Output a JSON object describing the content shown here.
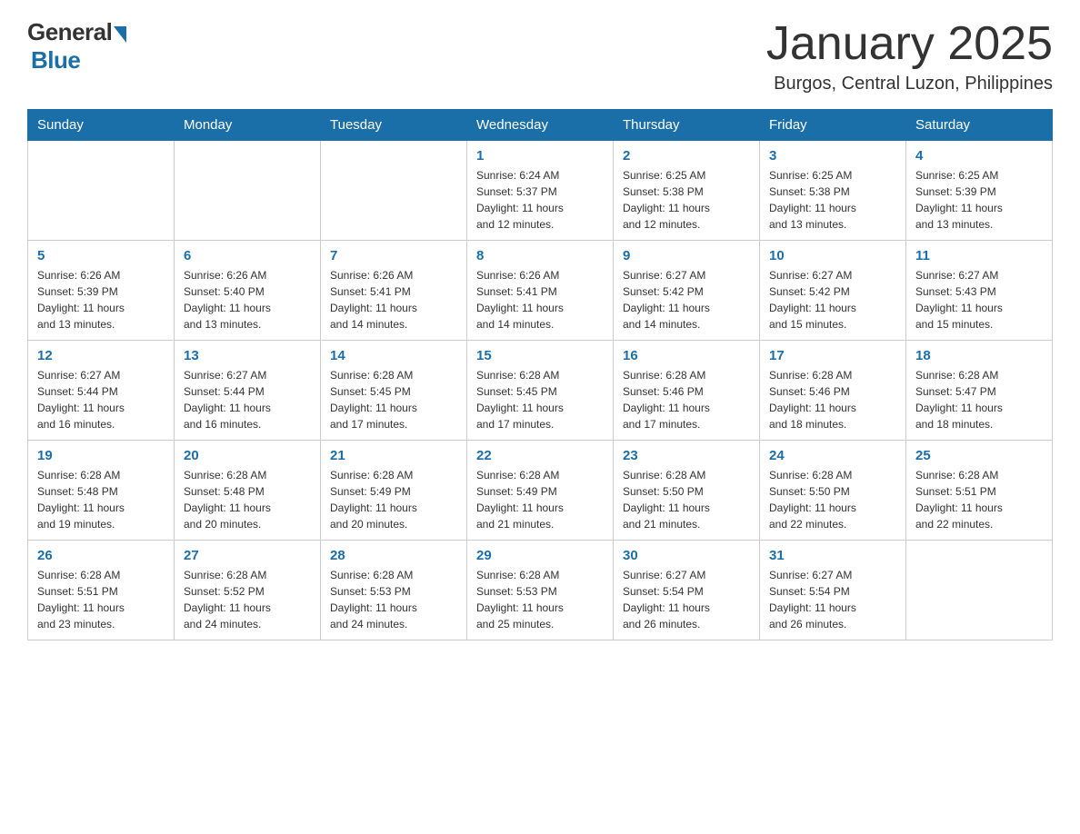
{
  "header": {
    "logo": {
      "general": "General",
      "blue": "Blue"
    },
    "title": "January 2025",
    "location": "Burgos, Central Luzon, Philippines"
  },
  "days_of_week": [
    "Sunday",
    "Monday",
    "Tuesday",
    "Wednesday",
    "Thursday",
    "Friday",
    "Saturday"
  ],
  "weeks": [
    [
      {
        "day": "",
        "info": ""
      },
      {
        "day": "",
        "info": ""
      },
      {
        "day": "",
        "info": ""
      },
      {
        "day": "1",
        "info": "Sunrise: 6:24 AM\nSunset: 5:37 PM\nDaylight: 11 hours\nand 12 minutes."
      },
      {
        "day": "2",
        "info": "Sunrise: 6:25 AM\nSunset: 5:38 PM\nDaylight: 11 hours\nand 12 minutes."
      },
      {
        "day": "3",
        "info": "Sunrise: 6:25 AM\nSunset: 5:38 PM\nDaylight: 11 hours\nand 13 minutes."
      },
      {
        "day": "4",
        "info": "Sunrise: 6:25 AM\nSunset: 5:39 PM\nDaylight: 11 hours\nand 13 minutes."
      }
    ],
    [
      {
        "day": "5",
        "info": "Sunrise: 6:26 AM\nSunset: 5:39 PM\nDaylight: 11 hours\nand 13 minutes."
      },
      {
        "day": "6",
        "info": "Sunrise: 6:26 AM\nSunset: 5:40 PM\nDaylight: 11 hours\nand 13 minutes."
      },
      {
        "day": "7",
        "info": "Sunrise: 6:26 AM\nSunset: 5:41 PM\nDaylight: 11 hours\nand 14 minutes."
      },
      {
        "day": "8",
        "info": "Sunrise: 6:26 AM\nSunset: 5:41 PM\nDaylight: 11 hours\nand 14 minutes."
      },
      {
        "day": "9",
        "info": "Sunrise: 6:27 AM\nSunset: 5:42 PM\nDaylight: 11 hours\nand 14 minutes."
      },
      {
        "day": "10",
        "info": "Sunrise: 6:27 AM\nSunset: 5:42 PM\nDaylight: 11 hours\nand 15 minutes."
      },
      {
        "day": "11",
        "info": "Sunrise: 6:27 AM\nSunset: 5:43 PM\nDaylight: 11 hours\nand 15 minutes."
      }
    ],
    [
      {
        "day": "12",
        "info": "Sunrise: 6:27 AM\nSunset: 5:44 PM\nDaylight: 11 hours\nand 16 minutes."
      },
      {
        "day": "13",
        "info": "Sunrise: 6:27 AM\nSunset: 5:44 PM\nDaylight: 11 hours\nand 16 minutes."
      },
      {
        "day": "14",
        "info": "Sunrise: 6:28 AM\nSunset: 5:45 PM\nDaylight: 11 hours\nand 17 minutes."
      },
      {
        "day": "15",
        "info": "Sunrise: 6:28 AM\nSunset: 5:45 PM\nDaylight: 11 hours\nand 17 minutes."
      },
      {
        "day": "16",
        "info": "Sunrise: 6:28 AM\nSunset: 5:46 PM\nDaylight: 11 hours\nand 17 minutes."
      },
      {
        "day": "17",
        "info": "Sunrise: 6:28 AM\nSunset: 5:46 PM\nDaylight: 11 hours\nand 18 minutes."
      },
      {
        "day": "18",
        "info": "Sunrise: 6:28 AM\nSunset: 5:47 PM\nDaylight: 11 hours\nand 18 minutes."
      }
    ],
    [
      {
        "day": "19",
        "info": "Sunrise: 6:28 AM\nSunset: 5:48 PM\nDaylight: 11 hours\nand 19 minutes."
      },
      {
        "day": "20",
        "info": "Sunrise: 6:28 AM\nSunset: 5:48 PM\nDaylight: 11 hours\nand 20 minutes."
      },
      {
        "day": "21",
        "info": "Sunrise: 6:28 AM\nSunset: 5:49 PM\nDaylight: 11 hours\nand 20 minutes."
      },
      {
        "day": "22",
        "info": "Sunrise: 6:28 AM\nSunset: 5:49 PM\nDaylight: 11 hours\nand 21 minutes."
      },
      {
        "day": "23",
        "info": "Sunrise: 6:28 AM\nSunset: 5:50 PM\nDaylight: 11 hours\nand 21 minutes."
      },
      {
        "day": "24",
        "info": "Sunrise: 6:28 AM\nSunset: 5:50 PM\nDaylight: 11 hours\nand 22 minutes."
      },
      {
        "day": "25",
        "info": "Sunrise: 6:28 AM\nSunset: 5:51 PM\nDaylight: 11 hours\nand 22 minutes."
      }
    ],
    [
      {
        "day": "26",
        "info": "Sunrise: 6:28 AM\nSunset: 5:51 PM\nDaylight: 11 hours\nand 23 minutes."
      },
      {
        "day": "27",
        "info": "Sunrise: 6:28 AM\nSunset: 5:52 PM\nDaylight: 11 hours\nand 24 minutes."
      },
      {
        "day": "28",
        "info": "Sunrise: 6:28 AM\nSunset: 5:53 PM\nDaylight: 11 hours\nand 24 minutes."
      },
      {
        "day": "29",
        "info": "Sunrise: 6:28 AM\nSunset: 5:53 PM\nDaylight: 11 hours\nand 25 minutes."
      },
      {
        "day": "30",
        "info": "Sunrise: 6:27 AM\nSunset: 5:54 PM\nDaylight: 11 hours\nand 26 minutes."
      },
      {
        "day": "31",
        "info": "Sunrise: 6:27 AM\nSunset: 5:54 PM\nDaylight: 11 hours\nand 26 minutes."
      },
      {
        "day": "",
        "info": ""
      }
    ]
  ]
}
